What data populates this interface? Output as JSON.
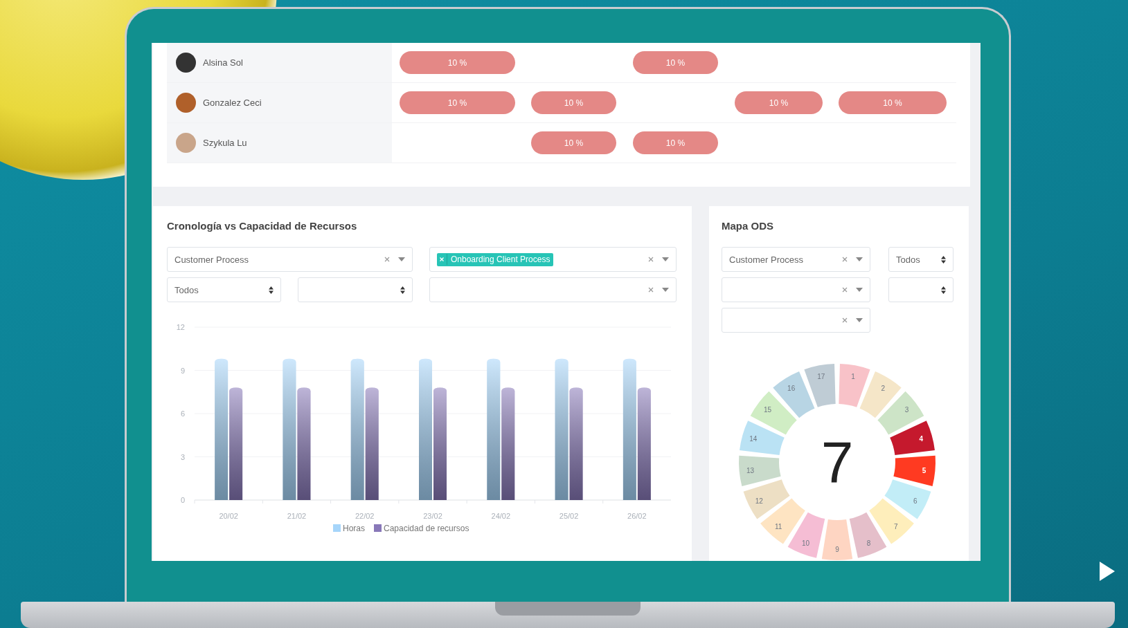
{
  "resource_table": {
    "rows": [
      {
        "name": "Alsina Sol",
        "cells": [
          "10 %",
          null,
          "10 %",
          null,
          null
        ]
      },
      {
        "name": "Gonzalez Ceci",
        "cells": [
          "10 %",
          "10 %",
          null,
          "10 %",
          "10 %"
        ]
      },
      {
        "name": "Szykula Lu",
        "cells": [
          null,
          "10 %",
          "10 %",
          null,
          null
        ]
      }
    ]
  },
  "timeline_panel": {
    "title": "Cronología vs Capacidad de Recursos",
    "filters": [
      {
        "kind": "select",
        "value": "Customer Process"
      },
      {
        "kind": "tags",
        "tags": [
          "Onboarding Client Process"
        ]
      },
      {
        "kind": "spinner",
        "value": "Todos"
      },
      {
        "kind": "spinner"
      },
      {
        "kind": "select"
      }
    ],
    "chart_data": {
      "type": "bar",
      "categories": [
        "20/02",
        "21/02",
        "22/02",
        "23/02",
        "24/02",
        "25/02",
        "26/02"
      ],
      "series": [
        {
          "name": "Horas",
          "color": "#a6d5fa",
          "values": [
            9.8,
            9.8,
            9.8,
            9.8,
            9.8,
            9.8,
            9.8
          ]
        },
        {
          "name": "Capacidad de recursos",
          "color": "#8878b8",
          "values": [
            7.8,
            7.8,
            7.8,
            7.8,
            7.8,
            7.8,
            7.8
          ]
        }
      ],
      "ylim": [
        0,
        12
      ],
      "yticks": [
        0,
        3,
        6,
        9,
        12
      ],
      "grid": true,
      "legend": true
    }
  },
  "ods_panel": {
    "title": "Mapa ODS",
    "filters": [
      {
        "kind": "select",
        "value": "Customer Process"
      },
      {
        "kind": "spinner",
        "value": "Todos"
      },
      {
        "kind": "select"
      },
      {
        "kind": "spinner"
      },
      {
        "kind": "select"
      }
    ],
    "center_value": "7",
    "goals": [
      {
        "number": "1",
        "color": "#f8c2c8",
        "selected": false
      },
      {
        "number": "2",
        "color": "#f5e6c8",
        "selected": false
      },
      {
        "number": "3",
        "color": "#cde4c7",
        "selected": false
      },
      {
        "number": "4",
        "color": "#c5192d",
        "selected": true
      },
      {
        "number": "5",
        "color": "#ff3a21",
        "selected": true
      },
      {
        "number": "6",
        "color": "#c2edf7",
        "selected": false
      },
      {
        "number": "7",
        "color": "#feeebb",
        "selected": false
      },
      {
        "number": "8",
        "color": "#e5bfca",
        "selected": false
      },
      {
        "number": "9",
        "color": "#fed5c2",
        "selected": false
      },
      {
        "number": "10",
        "color": "#f5bdd4",
        "selected": false
      },
      {
        "number": "11",
        "color": "#fee4c2",
        "selected": false
      },
      {
        "number": "12",
        "color": "#eddfc4",
        "selected": false
      },
      {
        "number": "13",
        "color": "#c9dbcb",
        "selected": false
      },
      {
        "number": "14",
        "color": "#bae2f4",
        "selected": false
      },
      {
        "number": "15",
        "color": "#d0edc4",
        "selected": false
      },
      {
        "number": "16",
        "color": "#b8d5e4",
        "selected": false
      },
      {
        "number": "17",
        "color": "#bfccd5",
        "selected": false
      }
    ]
  }
}
